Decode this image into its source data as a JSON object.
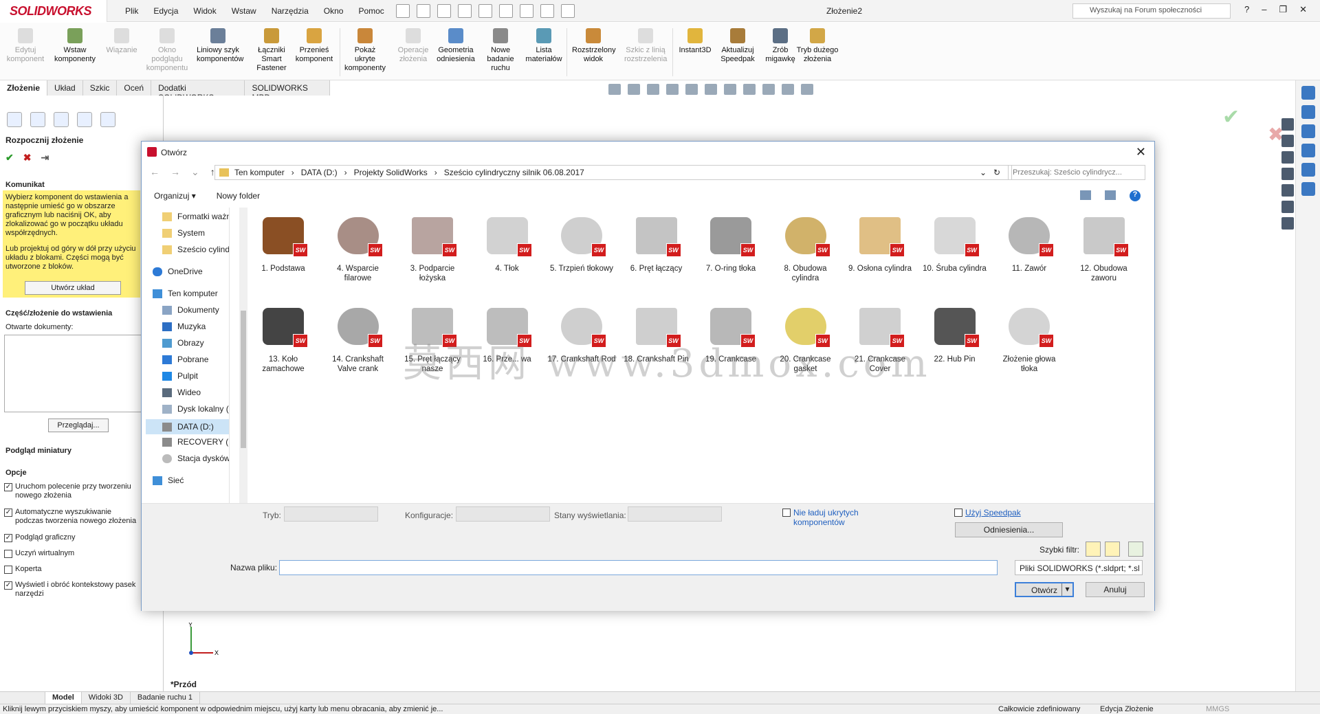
{
  "app": {
    "logo": "SOLIDWORKS",
    "title": "Złożenie2",
    "forum_search": "Wyszukaj na Forum społeczności"
  },
  "menu": [
    "Plik",
    "Edycja",
    "Widok",
    "Wstaw",
    "Narzędzia",
    "Okno",
    "Pomoc"
  ],
  "ribbon": [
    {
      "label": "Edytuj komponent",
      "disabled": true
    },
    {
      "label": "Wstaw komponenty",
      "disabled": false
    },
    {
      "label": "Wiązanie",
      "disabled": true
    },
    {
      "label": "Okno podglądu komponentu",
      "disabled": true
    },
    {
      "label": "Liniowy szyk komponentów",
      "disabled": false
    },
    {
      "label": "Łączniki Smart Fastener",
      "disabled": false
    },
    {
      "label": "Przenieś komponent",
      "disabled": false
    },
    {
      "label": "Pokaż ukryte komponenty",
      "disabled": false
    },
    {
      "label": "Operacje złożenia",
      "disabled": true
    },
    {
      "label": "Geometria odniesienia",
      "disabled": false
    },
    {
      "label": "Nowe badanie ruchu",
      "disabled": false
    },
    {
      "label": "Lista materiałów",
      "disabled": false
    },
    {
      "label": "Rozstrzelony widok",
      "disabled": false
    },
    {
      "label": "Szkic z linią rozstrzelenia",
      "disabled": true
    },
    {
      "label": "Instant3D",
      "disabled": false
    },
    {
      "label": "Aktualizuj Speedpak",
      "disabled": false
    },
    {
      "label": "Zrób migawkę",
      "disabled": false
    },
    {
      "label": "Tryb dużego złożenia",
      "disabled": false
    }
  ],
  "tabs": [
    "Złożenie",
    "Układ",
    "Szkic",
    "Oceń",
    "Dodatki SOLIDWORKS",
    "SOLIDWORKS MBD"
  ],
  "panel": {
    "title": "Rozpocznij złożenie",
    "msg_head": "Komunikat",
    "msg1": "Wybierz komponent do wstawienia a następnie umieść go w obszarze graficznym lub naciśnij OK, aby zlokalizować go w początku układu współrzędnych.",
    "msg2": "Lub projektuj od góry w dół przy użyciu układu z blokami. Części mogą być utworzone z bloków.",
    "create_layout": "Utwórz układ",
    "part_head": "Część/złożenie do wstawienia",
    "open_docs": "Otwarte dokumenty:",
    "browse": "Przeglądaj...",
    "preview": "Podgląd miniatury",
    "options": "Opcje",
    "opts": [
      {
        "label": "Uruchom polecenie przy tworzeniu nowego złożenia",
        "checked": true
      },
      {
        "label": "Automatyczne wyszukiwanie podczas tworzenia nowego złożenia",
        "checked": true
      },
      {
        "label": "Podgląd graficzny",
        "checked": true
      },
      {
        "label": "Uczyń wirtualnym",
        "checked": false
      },
      {
        "label": "Koperta",
        "checked": false
      },
      {
        "label": "Wyświetl i obróć kontekstowy pasek narzędzi",
        "checked": true
      }
    ]
  },
  "viewport": {
    "front": "*Przód",
    "axis_y": "Y",
    "axis_x": "X"
  },
  "bottom_tabs": [
    "Model",
    "Widoki 3D",
    "Badanie ruchu 1"
  ],
  "status": {
    "hint": "Kliknij lewym przyciskiem myszy, aby umieścić komponent w odpowiednim miejscu, użyj karty lub menu obracania, aby zmienić je...",
    "state": "Całkowicie zdefiniowany",
    "mode": "Edycja Złożenie",
    "units": "MMGS"
  },
  "dialog": {
    "title": "Otwórz",
    "path": [
      "Ten komputer",
      "DATA (D:)",
      "Projekty SolidWorks",
      "Sześcio cylindryczny silnik 06.08.2017"
    ],
    "search_placeholder": "Przeszukaj: Sześcio cylindrycz...",
    "organize": "Organizuj ▾",
    "new_folder": "Nowy folder",
    "nav": [
      {
        "label": "Formatki ważne",
        "icon": "folder-icon"
      },
      {
        "label": "System",
        "icon": "folder-icon"
      },
      {
        "label": "Sześcio cylindryc",
        "icon": "folder-icon"
      },
      {
        "label": "OneDrive",
        "icon": "cloud-icon"
      },
      {
        "label": "Ten komputer",
        "icon": "computer-icon"
      },
      {
        "label": "Dokumenty",
        "icon": "documents-icon"
      },
      {
        "label": "Muzyka",
        "icon": "music-icon"
      },
      {
        "label": "Obrazy",
        "icon": "pictures-icon"
      },
      {
        "label": "Pobrane",
        "icon": "download-icon"
      },
      {
        "label": "Pulpit",
        "icon": "desktop-icon"
      },
      {
        "label": "Wideo",
        "icon": "video-icon"
      },
      {
        "label": "Dysk lokalny (C:)",
        "icon": "drive-icon"
      },
      {
        "label": "DATA (D:)",
        "icon": "drive-icon"
      },
      {
        "label": "RECOVERY (E:)",
        "icon": "drive-icon"
      },
      {
        "label": "Stacja dysków Bl",
        "icon": "disc-icon"
      },
      {
        "label": "Sieć",
        "icon": "network-icon"
      }
    ],
    "files": [
      "1. Podstawa",
      "4. Wsparcie filarowe",
      "3. Podparcie łożyska",
      "4. Tłok",
      "5. Trzpień tłokowy",
      "6. Pręt łączący",
      "7. O-ring tłoka",
      "8. Obudowa cylindra",
      "9. Osłona cylindra",
      "10. Śruba cylindra",
      "11. Zawór",
      "12. Obudowa zaworu",
      "13. Koło zamachowe",
      "14. Crankshaft Valve crank",
      "15. Pręt łączący nasze",
      "16. Prze... wa",
      "17. Crankshaft Rod",
      "18. Crankshaft Pin",
      "19. Crankcase",
      "20. Crankcase gasket",
      "21. Crankcase Cover",
      "22. Hub Pin",
      "Złożenie głowa tłoka"
    ],
    "watermark": "莫西网 www.3dmox.com",
    "mode_label": "Tryb:",
    "config_label": "Konfiguracje:",
    "display_label": "Stany wyświetlania:",
    "hidden_label": "Nie ładuj ukrytych komponentów",
    "speedpak_label": "Użyj Speedpak",
    "refs_btn": "Odniesienia...",
    "quick_filter": "Szybki filtr:",
    "filename_label": "Nazwa pliku:",
    "filename_value": "",
    "filetype": "Pliki SOLIDWORKS (*.sldprt; *.sl",
    "open_btn": "Otwórz",
    "cancel_btn": "Anuluj"
  }
}
